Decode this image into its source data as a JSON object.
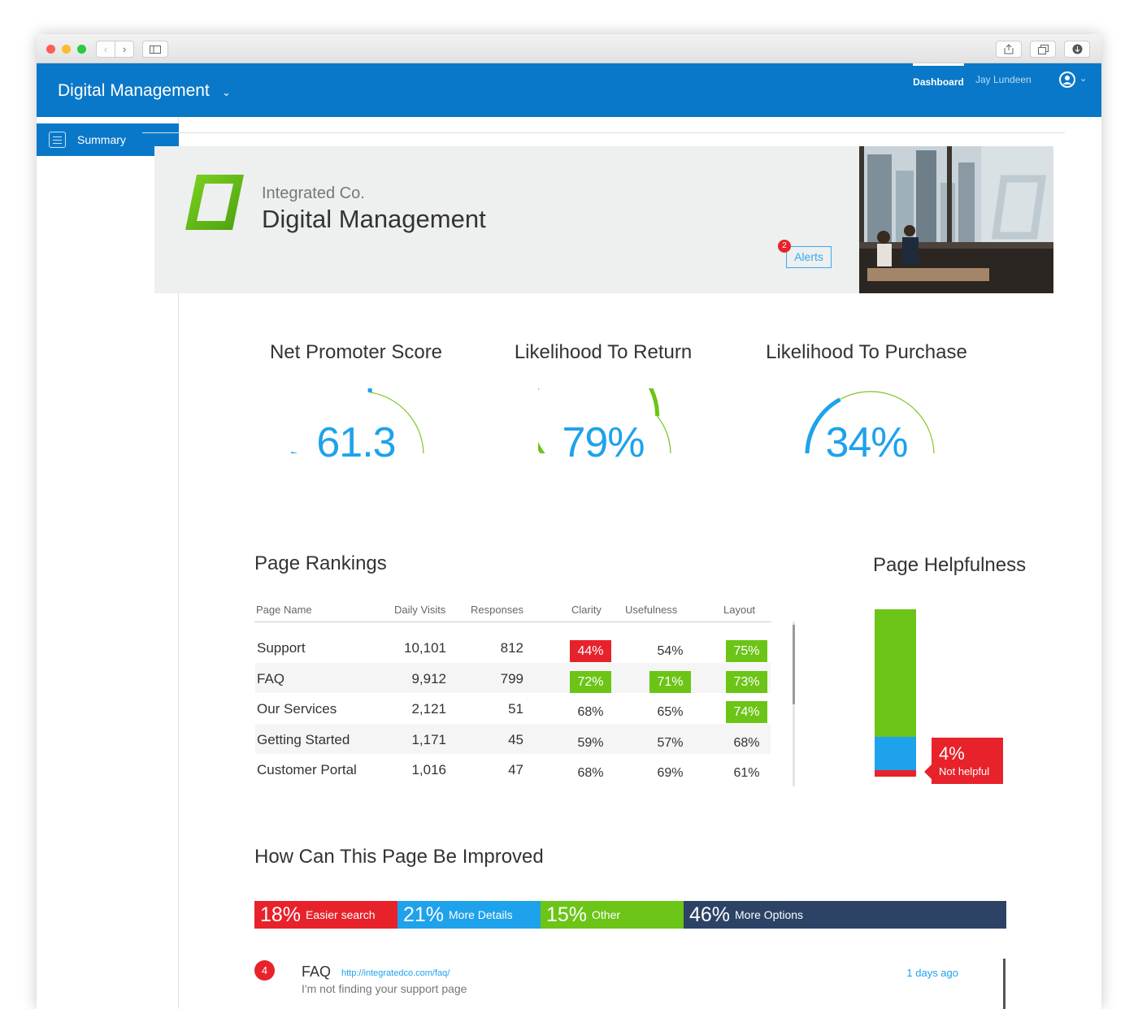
{
  "header": {
    "app_title": "Digital Management",
    "nav_dashboard": "Dashboard",
    "nav_user": "Jay Lundeen"
  },
  "sidebar": {
    "items": [
      {
        "label": "Summary",
        "icon": "list-icon"
      }
    ]
  },
  "hero": {
    "company": "Integrated Co.",
    "title": "Digital Management",
    "alerts_label": "Alerts",
    "alerts_count": "2",
    "logo_color": "#6cc417"
  },
  "gauges": [
    {
      "title": "Net Promoter Score",
      "value": "61.3",
      "fraction": 0.55,
      "color": "#1ea2ec",
      "track": "#7ec624"
    },
    {
      "title": "Likelihood To Return",
      "value": "79%",
      "fraction": 0.79,
      "color": "#6cc417",
      "track": "#6cc417"
    },
    {
      "title": "Likelihood To Purchase",
      "value": "34%",
      "fraction": 0.34,
      "color": "#1ea2ec",
      "track": "#7ec624"
    }
  ],
  "rankings": {
    "title": "Page Rankings",
    "columns": [
      "Page Name",
      "Daily Visits",
      "Responses",
      "Clarity",
      "Usefulness",
      "Layout"
    ],
    "rows": [
      {
        "name": "Support",
        "visits": "10,101",
        "responses": "812",
        "clarity": "44%",
        "usefulness": "54%",
        "layout": "75%",
        "clarity_status": "bad",
        "usefulness_status": "none",
        "layout_status": "good"
      },
      {
        "name": "FAQ",
        "visits": "9,912",
        "responses": "799",
        "clarity": "72%",
        "usefulness": "71%",
        "layout": "73%",
        "clarity_status": "good",
        "usefulness_status": "good",
        "layout_status": "good"
      },
      {
        "name": "Our Services",
        "visits": "2,121",
        "responses": "51",
        "clarity": "68%",
        "usefulness": "65%",
        "layout": "74%",
        "clarity_status": "none",
        "usefulness_status": "none",
        "layout_status": "good"
      },
      {
        "name": "Getting Started",
        "visits": "1,171",
        "responses": "45",
        "clarity": "59%",
        "usefulness": "57%",
        "layout": "68%",
        "clarity_status": "none",
        "usefulness_status": "none",
        "layout_status": "none"
      },
      {
        "name": "Customer Portal",
        "visits": "1,016",
        "responses": "47",
        "clarity": "68%",
        "usefulness": "69%",
        "layout": "61%",
        "clarity_status": "none",
        "usefulness_status": "none",
        "layout_status": "none"
      }
    ],
    "status_colors": {
      "good": "#6cc417",
      "bad": "#e8222b"
    }
  },
  "helpfulness": {
    "title": "Page Helpfulness",
    "segments": [
      {
        "fraction": 0.76,
        "color": "#6cc417"
      },
      {
        "fraction": 0.2,
        "color": "#1ea2ec"
      },
      {
        "fraction": 0.04,
        "color": "#e8222b"
      }
    ],
    "callout_value": "4%",
    "callout_label": "Not helpful"
  },
  "improve": {
    "title": "How Can This Page Be Improved",
    "segments": [
      {
        "pct": "18%",
        "label": "Easier search",
        "value": 18,
        "color": "#e8222b"
      },
      {
        "pct": "21%",
        "label": "More Details",
        "value": 21,
        "color": "#1ea2ec"
      },
      {
        "pct": "15%",
        "label": "Other",
        "value": 15,
        "color": "#6cc417"
      },
      {
        "pct": "46%",
        "label": "More Options",
        "value": 46,
        "color": "#2c4366"
      }
    ]
  },
  "comment": {
    "count": "4",
    "title": "FAQ",
    "link": "http://integratedco.com/faq/",
    "text": "I'm not finding your support page",
    "time": "1 days ago"
  }
}
